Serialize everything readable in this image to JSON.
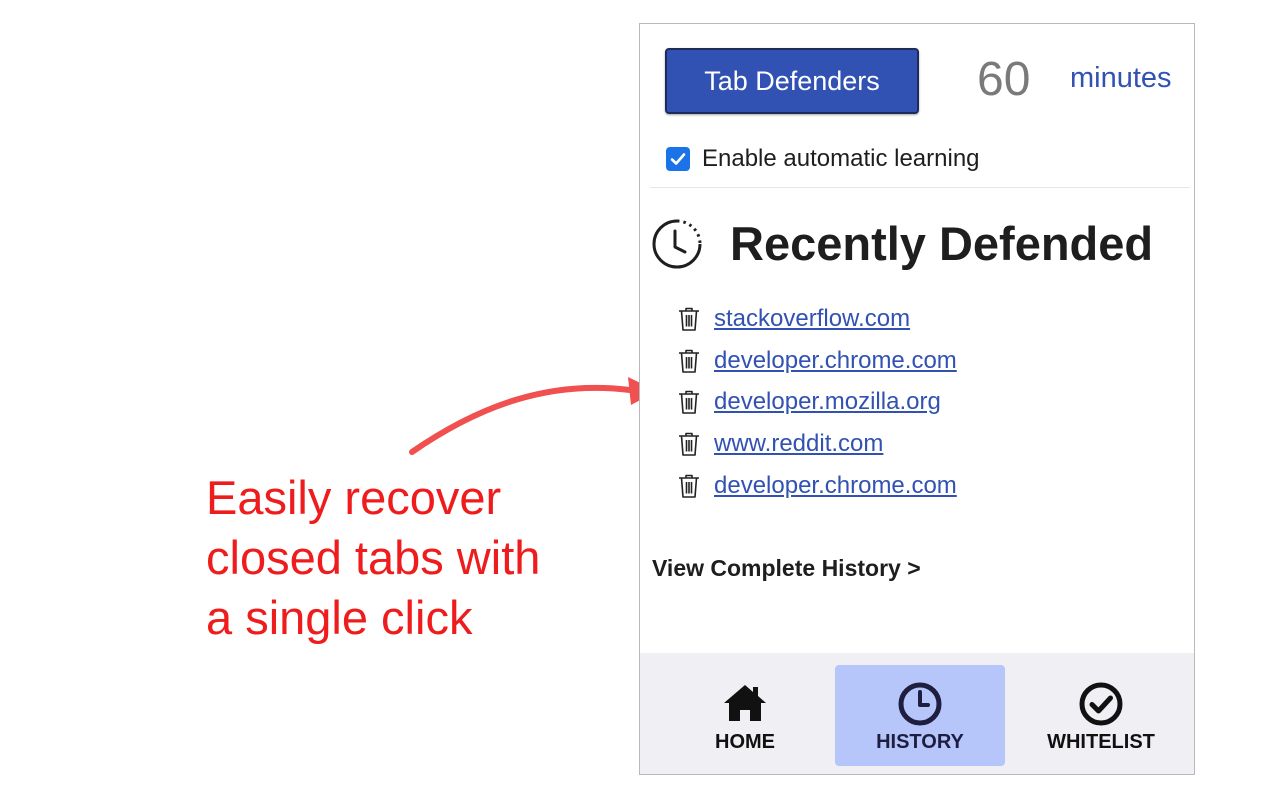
{
  "caption": {
    "lines": [
      "Easily recover",
      "closed tabs with",
      "a single click"
    ],
    "color": "#ee1c1c"
  },
  "popup": {
    "brand_button": "Tab Defenders",
    "minutes_value": "60",
    "minutes_label": "minutes",
    "auto_learning": {
      "label": "Enable automatic learning",
      "checked": true
    },
    "section_title": "Recently Defended",
    "history": [
      {
        "url": "stackoverflow.com",
        "icon": "trash-icon"
      },
      {
        "url": "developer.chrome.com",
        "icon": "trash-icon"
      },
      {
        "url": "developer.mozilla.org",
        "icon": "trash-icon"
      },
      {
        "url": "www.reddit.com",
        "icon": "trash-icon"
      },
      {
        "url": "developer.chrome.com",
        "icon": "trash-icon"
      }
    ],
    "view_history_link": "View Complete History >",
    "nav": [
      {
        "label": "HOME",
        "icon": "home-icon",
        "active": false
      },
      {
        "label": "HISTORY",
        "icon": "clock-icon",
        "active": true
      },
      {
        "label": "WHITELIST",
        "icon": "check-circle-icon",
        "active": false
      }
    ],
    "colors": {
      "primary": "#3152b2",
      "active_nav_bg": "#b6c6fb",
      "nav_bg": "#efeff4",
      "checkbox": "#1a73e8"
    }
  }
}
